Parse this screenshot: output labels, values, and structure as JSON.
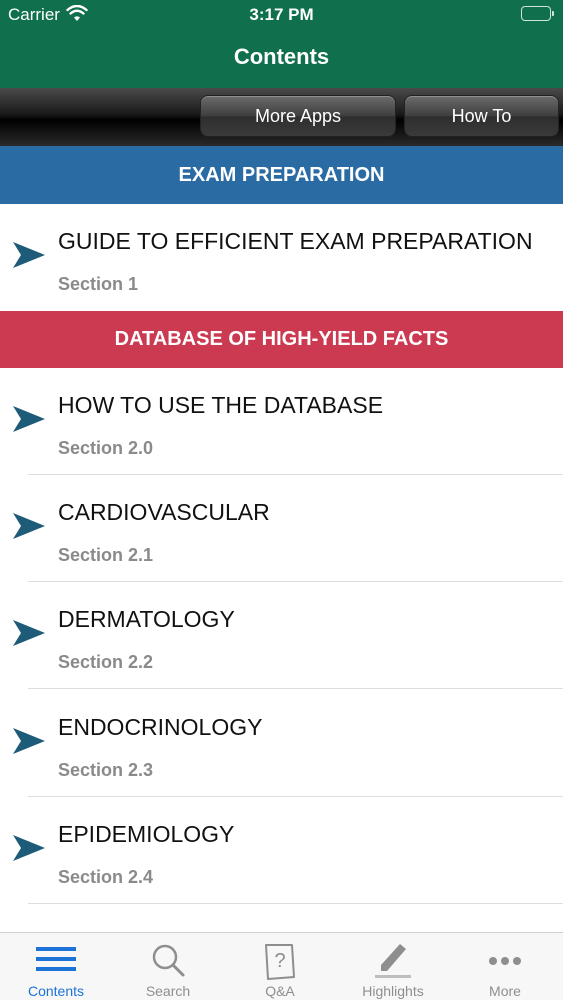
{
  "status": {
    "carrier": "Carrier",
    "time": "3:17 PM"
  },
  "nav": {
    "title": "Contents"
  },
  "toolbar": {
    "more_apps_label": "More Apps",
    "how_to_label": "How To"
  },
  "sections": [
    {
      "header": "EXAM PREPARATION",
      "color": "#2a6ba3"
    },
    {
      "header": "DATABASE OF HIGH-YIELD FACTS",
      "color": "#cc3a52"
    }
  ],
  "rows": [
    {
      "title": "GUIDE TO EFFICIENT EXAM PREPARATION",
      "subtitle": "Section 1"
    },
    {
      "title": "HOW TO USE THE DATABASE",
      "subtitle": "Section 2.0"
    },
    {
      "title": "CARDIOVASCULAR",
      "subtitle": "Section 2.1"
    },
    {
      "title": "DERMATOLOGY",
      "subtitle": "Section 2.2"
    },
    {
      "title": "ENDOCRINOLOGY",
      "subtitle": "Section 2.3"
    },
    {
      "title": "EPIDEMIOLOGY",
      "subtitle": "Section 2.4"
    }
  ],
  "tabs": [
    {
      "label": "Contents",
      "icon": "list-icon",
      "active": true
    },
    {
      "label": "Search",
      "icon": "search-icon",
      "active": false
    },
    {
      "label": "Q&A",
      "icon": "question-icon",
      "active": false
    },
    {
      "label": "Highlights",
      "icon": "highlighter-icon",
      "active": false
    },
    {
      "label": "More",
      "icon": "ellipsis-icon",
      "active": false
    }
  ],
  "colors": {
    "brand": "#10704e",
    "active_tab": "#1b73d8",
    "chevron": "#1e5b78"
  }
}
